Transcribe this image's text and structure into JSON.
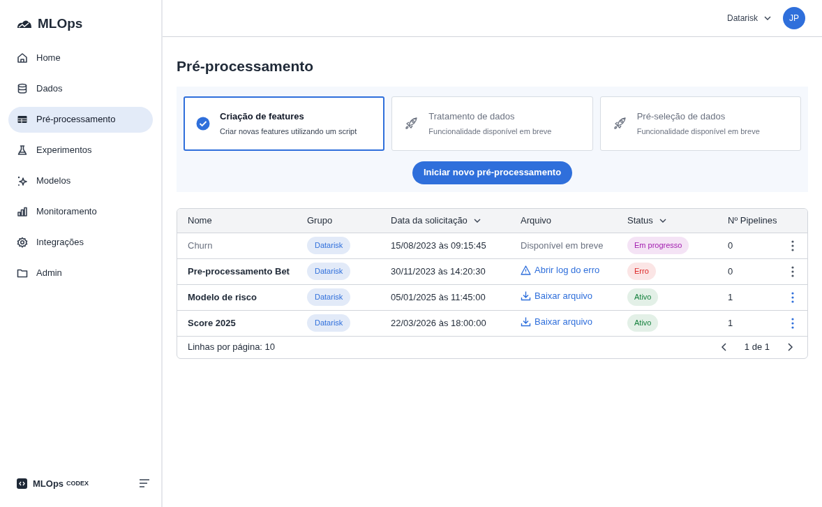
{
  "sidebar": {
    "brand": "MLOps",
    "items": [
      {
        "label": "Home",
        "kind": "home",
        "selected": false
      },
      {
        "label": "Dados",
        "kind": "database",
        "selected": false
      },
      {
        "label": "Pré-processamento",
        "kind": "table",
        "selected": true
      },
      {
        "label": "Experimentos",
        "kind": "flask",
        "selected": false
      },
      {
        "label": "Modelos",
        "kind": "sparkles",
        "selected": false
      },
      {
        "label": "Monitoramento",
        "kind": "bars",
        "selected": false
      },
      {
        "label": "Integrações",
        "kind": "gear",
        "selected": false
      },
      {
        "label": "Admin",
        "kind": "folder",
        "selected": false
      }
    ],
    "footer": {
      "brand": "MLOps",
      "sub": "CODEX"
    }
  },
  "header": {
    "org": "Datarisk",
    "avatar": "JP"
  },
  "page": {
    "title": "Pré-processamento",
    "options": [
      {
        "title": "Criação de features",
        "subtitle": "Criar novas features utilizando um script",
        "selected": true,
        "disabled": false
      },
      {
        "title": "Tratamento de dados",
        "subtitle": "Funcionalidade disponível em breve",
        "selected": false,
        "disabled": true
      },
      {
        "title": "Pré-seleção de dados",
        "subtitle": "Funcionalidade disponível em breve",
        "selected": false,
        "disabled": true
      }
    ],
    "primary_button": "Iniciar novo pré-processamento"
  },
  "table": {
    "columns": [
      {
        "label": "Nome",
        "sortable": false
      },
      {
        "label": "Grupo",
        "sortable": false
      },
      {
        "label": "Data da solicitação",
        "sortable": true
      },
      {
        "label": "Arquivo",
        "sortable": false
      },
      {
        "label": "Status",
        "sortable": true
      },
      {
        "label": "Nº Pipelines",
        "sortable": false
      }
    ],
    "rows": [
      {
        "name": "Churn",
        "group": "Datarisk",
        "date": "15/08/2023 às 09:15:45",
        "file": {
          "kind": "unavailable",
          "label": "Disponível em breve"
        },
        "status": {
          "label": "Em progresso",
          "color": "#a21caf"
        },
        "pipelines": "0",
        "disabled": true,
        "actions_enabled": false
      },
      {
        "name": "Pre-processamento Bet",
        "group": "Datarisk",
        "date": "30/11/2023 às 14:20:30",
        "file": {
          "kind": "error",
          "label": "Abrir log do erro"
        },
        "status": {
          "label": "Erro",
          "color": "#dc2626"
        },
        "pipelines": "0",
        "disabled": false,
        "actions_enabled": false
      },
      {
        "name": "Modelo de risco",
        "group": "Datarisk",
        "date": "05/01/2025 às 11:45:00",
        "file": {
          "kind": "download",
          "label": "Baixar arquivo"
        },
        "status": {
          "label": "Ativo",
          "color": "#15803d"
        },
        "pipelines": "1",
        "disabled": false,
        "actions_enabled": true
      },
      {
        "name": "Score 2025",
        "group": "Datarisk",
        "date": "22/03/2026 às 18:00:00",
        "file": {
          "kind": "download",
          "label": "Baixar arquivo"
        },
        "status": {
          "label": "Ativo",
          "color": "#15803d"
        },
        "pipelines": "1",
        "disabled": false,
        "actions_enabled": true
      }
    ],
    "footer": {
      "rows_per_page": "Linhas por página: 10",
      "pagination": "1 de 1"
    }
  }
}
